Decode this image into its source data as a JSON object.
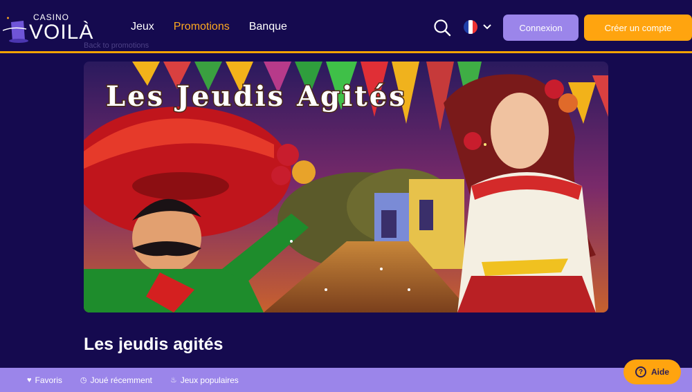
{
  "brand": {
    "small": "CASINO",
    "big": "VOILÀ"
  },
  "nav": [
    {
      "label": "Jeux"
    },
    {
      "label": "Promotions",
      "active": true
    },
    {
      "label": "Banque"
    }
  ],
  "breadcrumb": "Back to promotions",
  "buttons": {
    "login": "Connexion",
    "signup": "Créer un compte"
  },
  "banner": {
    "headline": "Les Jeudis Agités"
  },
  "promo": {
    "title": "Les jeudis agités"
  },
  "bottombar": [
    {
      "label": "Favoris",
      "icon": "heart-icon"
    },
    {
      "label": "Joué récemment",
      "icon": "clock-icon"
    },
    {
      "label": "Jeux populaires",
      "icon": "flame-icon"
    }
  ],
  "help": {
    "label": "Aide"
  },
  "colors": {
    "background": "#150a4f",
    "accent": "#ffa40f",
    "secondary": "#9b85ea"
  }
}
